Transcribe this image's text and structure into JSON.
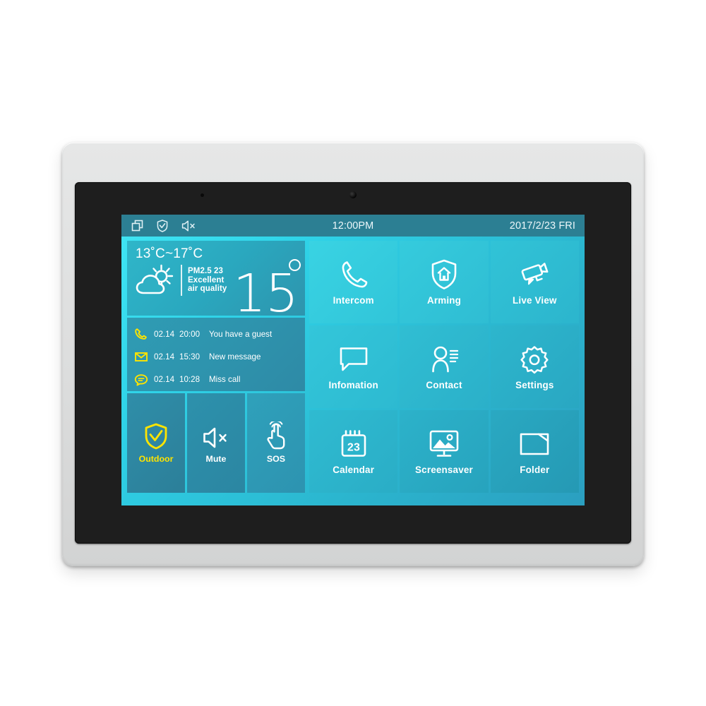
{
  "device": {
    "name": "indoor-station-touch-panel",
    "frame_color": "#e0e1e1",
    "bezel_color": "#1e1e1e"
  },
  "statusbar": {
    "icons": [
      {
        "name": "windows-copy-icon",
        "label": "multi-window"
      },
      {
        "name": "shield-check-icon",
        "label": "arming-status"
      },
      {
        "name": "speaker-mute-icon",
        "label": "mute-status"
      }
    ],
    "time": "12:00PM",
    "date": "2017/2/23 FRI",
    "background": "#2c7f93"
  },
  "weather": {
    "range": "13˚C~17˚C",
    "icon": "sun-behind-cloud-icon",
    "pm_label": "PM2.5  23",
    "quality_line1": "Excellent",
    "quality_line2": "air  quality",
    "current_temp": "15",
    "degree_symbol": "°"
  },
  "notifications": [
    {
      "icon": "phone-call-icon",
      "date": "02.14",
      "time": "20:00",
      "text": "You have a guest"
    },
    {
      "icon": "envelope-icon",
      "date": "02.14",
      "time": "15:30",
      "text": "New message"
    },
    {
      "icon": "chat-bubble-icon",
      "date": "02.14",
      "time": "10:28",
      "text": "Miss call"
    }
  ],
  "quick_actions": [
    {
      "icon": "shield-check-icon",
      "label": "Outdoor",
      "active": true,
      "active_color": "#ffe400"
    },
    {
      "icon": "speaker-mute-icon",
      "label": "Mute",
      "active": false
    },
    {
      "icon": "sos-hand-icon",
      "label": "SOS",
      "active": false
    }
  ],
  "apps": [
    {
      "icon": "phone-handset-icon",
      "label": "Intercom"
    },
    {
      "icon": "shield-house-icon",
      "label": "Arming"
    },
    {
      "icon": "cctv-camera-icon",
      "label": "Live  View"
    },
    {
      "icon": "speech-bubble-icon",
      "label": "Infomation"
    },
    {
      "icon": "contact-person-icon",
      "label": "Contact"
    },
    {
      "icon": "gear-icon",
      "label": "Settings"
    },
    {
      "icon": "calendar-icon",
      "label": "Calendar",
      "day": "23"
    },
    {
      "icon": "picture-screen-icon",
      "label": "Screensaver"
    },
    {
      "icon": "folder-icon",
      "label": "Folder"
    }
  ],
  "theme": {
    "screen_accent": "#3fe4f3",
    "panel_teal": "#2e94ad",
    "status_teal": "#2c7f93",
    "highlight_yellow": "#ffe400"
  }
}
